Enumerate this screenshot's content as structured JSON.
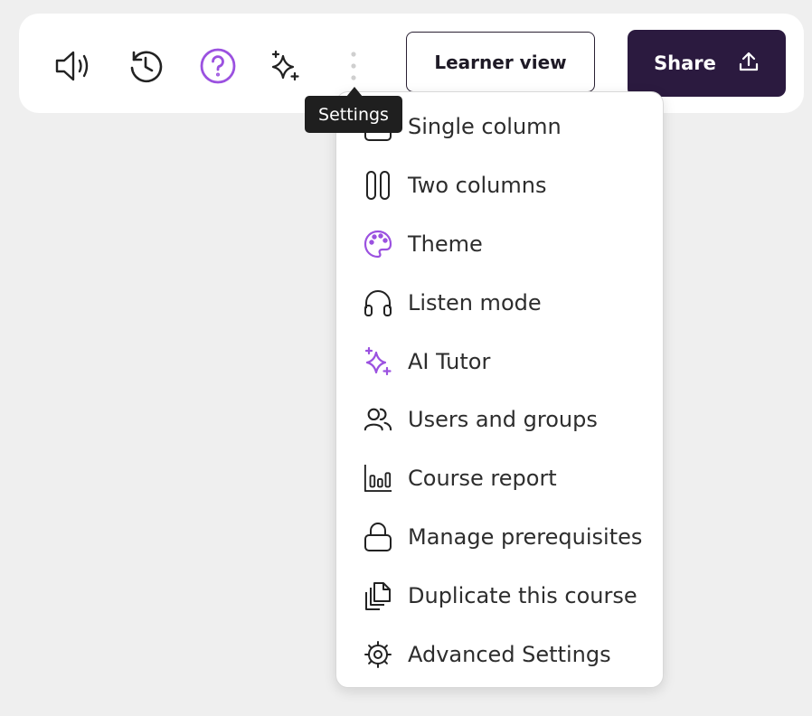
{
  "toolbar": {
    "icons": [
      "speaker-icon",
      "history-icon",
      "help-icon",
      "ai-sparkle-icon",
      "more-vertical-icon"
    ],
    "learner_view_label": "Learner view",
    "share_label": "Share"
  },
  "tooltip": {
    "text": "Settings"
  },
  "menu": {
    "items": [
      {
        "label": "Single column",
        "icon": "single-column-icon"
      },
      {
        "label": "Two columns",
        "icon": "two-columns-icon"
      },
      {
        "label": "Theme",
        "icon": "palette-icon"
      },
      {
        "label": "Listen mode",
        "icon": "headphones-icon"
      },
      {
        "label": "AI Tutor",
        "icon": "ai-sparkle-icon"
      },
      {
        "label": "Users and groups",
        "icon": "users-icon"
      },
      {
        "label": "Course report",
        "icon": "bar-chart-icon"
      },
      {
        "label": "Manage prerequisites",
        "icon": "lock-icon"
      },
      {
        "label": "Duplicate this course",
        "icon": "duplicate-icon"
      },
      {
        "label": "Advanced Settings",
        "icon": "gear-icon"
      }
    ]
  },
  "colors": {
    "accent_purple": "#9b51e0",
    "share_bg": "#2b1a3f",
    "tooltip_bg": "#1f1f1f",
    "page_bg": "#efefef"
  }
}
